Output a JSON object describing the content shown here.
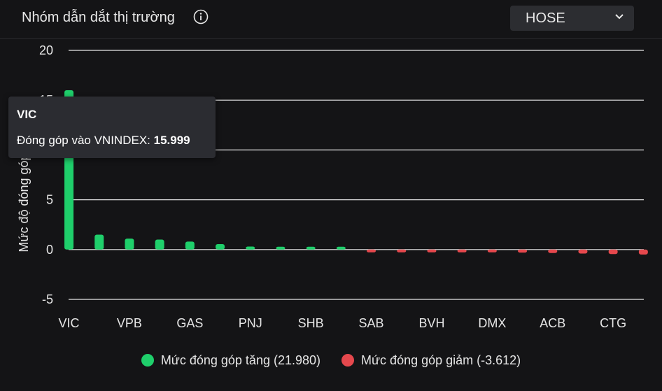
{
  "header": {
    "title": "Nhóm dẫn dắt thị trường",
    "info_icon": "info-circle-icon",
    "exchange": "HOSE",
    "dropdown_icon": "chevron-down-icon"
  },
  "colors": {
    "up": "#1fcf6b",
    "down": "#e5484d",
    "grid": "#e8e8e8",
    "text": "#e6e6e6"
  },
  "tooltip": {
    "name": "VIC",
    "label": "Đóng góp vào VNINDEX:",
    "value": "15.999"
  },
  "legend": {
    "up_label": "Mức đóng góp tăng (21.980)",
    "down_label": "Mức đóng góp giảm (-3.612)"
  },
  "chart_data": {
    "type": "bar",
    "ylabel": "Mức độ đóng góp",
    "ylim": [
      -5,
      20
    ],
    "yticks": [
      20,
      15,
      10,
      5,
      0,
      -5
    ],
    "grid": true,
    "legend_position": "bottom",
    "categories": [
      "VIC",
      "",
      "VPB",
      "",
      "GAS",
      "",
      "PNJ",
      "",
      "SHB",
      "",
      "SAB",
      "",
      "BVH",
      "",
      "DMX",
      "",
      "ACB",
      "",
      "CTG",
      ""
    ],
    "series": [
      {
        "name": "Mức đóng góp tăng (21.980)",
        "values": [
          15.999,
          1.5,
          1.1,
          1.0,
          0.8,
          0.55,
          0.3,
          0.25,
          0.15,
          0.12,
          null,
          null,
          null,
          null,
          null,
          null,
          null,
          null,
          null,
          null
        ]
      },
      {
        "name": "Mức đóng góp giảm (-3.612)",
        "values": [
          null,
          null,
          null,
          null,
          null,
          null,
          null,
          null,
          null,
          null,
          -0.1,
          -0.15,
          -0.2,
          -0.22,
          -0.25,
          -0.3,
          -0.35,
          -0.4,
          -0.45,
          -0.5
        ]
      }
    ]
  }
}
